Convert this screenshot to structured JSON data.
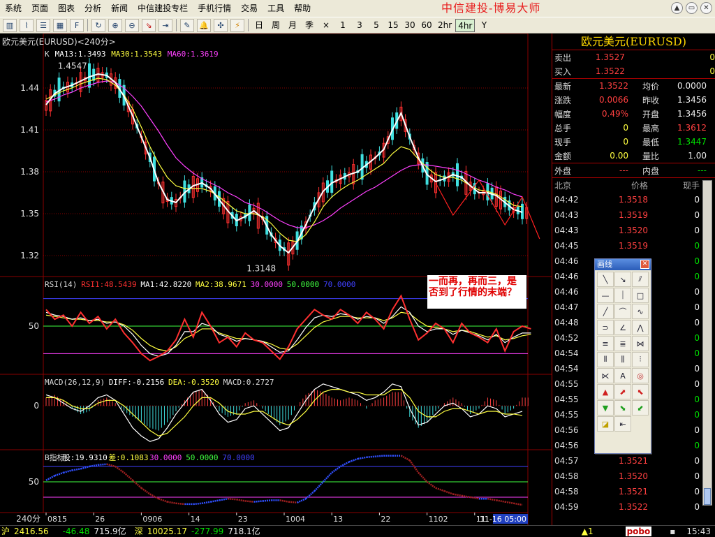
{
  "app": {
    "brand": "中信建投-博易大师",
    "menu": [
      "系统",
      "页面",
      "图表",
      "分析",
      "新闻",
      "中信建投专栏",
      "手机行情",
      "交易",
      "工具",
      "帮助"
    ],
    "window_buttons": [
      "▲",
      "▭",
      "✕"
    ]
  },
  "toolbar": {
    "periods": [
      "日",
      "周",
      "月",
      "季",
      "×",
      "1",
      "3",
      "5",
      "15",
      "30",
      "60",
      "2hr",
      "4hr",
      "Y"
    ],
    "active_period": "4hr"
  },
  "chart": {
    "title": "欧元美元(EURUSD)<240分>",
    "annotation": "一而再，再而三，是否到了行情的末端？",
    "high_label": "1.4547",
    "low_label": "1.3148"
  },
  "chart_data": [
    {
      "type": "line",
      "panel": "K",
      "legend": [
        {
          "text": "K",
          "color": "#dddddd"
        },
        {
          "text": "MA13:1.3493",
          "color": "#ffffff"
        },
        {
          "text": "MA30:1.3543",
          "color": "#ffff40"
        },
        {
          "text": "MA60:1.3619",
          "color": "#ff40ff"
        }
      ],
      "y_ticks": [
        1.44,
        1.41,
        1.38,
        1.35,
        1.32
      ],
      "ylim": [
        1.305,
        1.47
      ],
      "x_ticks": [
        "0815",
        "26",
        "0906",
        "14",
        "23",
        "1004",
        "13",
        "22",
        "1102",
        "11",
        "11-16 05:00"
      ],
      "x_ticks_index": [
        0,
        12,
        24,
        36,
        48,
        60,
        72,
        84,
        96,
        108,
        120
      ],
      "high": 1.4547,
      "low": 1.3148,
      "series": [
        {
          "name": "MA13",
          "color": "#ffffff",
          "values": [
            1.428,
            1.436,
            1.44,
            1.442,
            1.445,
            1.448,
            1.45,
            1.449,
            1.444,
            1.434,
            1.42,
            1.405,
            1.39,
            1.372,
            1.36,
            1.358,
            1.365,
            1.37,
            1.372,
            1.368,
            1.36,
            1.352,
            1.345,
            1.348,
            1.352,
            1.347,
            1.335,
            1.327,
            1.322,
            1.33,
            1.342,
            1.355,
            1.366,
            1.372,
            1.375,
            1.378,
            1.38,
            1.385,
            1.39,
            1.396,
            1.41,
            1.422,
            1.405,
            1.39,
            1.378,
            1.373,
            1.375,
            1.378,
            1.376,
            1.37,
            1.365,
            1.365,
            1.363,
            1.358,
            1.353,
            1.351
          ]
        },
        {
          "name": "MA30",
          "color": "#ffff40",
          "values": [
            1.432,
            1.435,
            1.438,
            1.44,
            1.443,
            1.445,
            1.447,
            1.446,
            1.442,
            1.435,
            1.425,
            1.412,
            1.398,
            1.386,
            1.376,
            1.37,
            1.368,
            1.368,
            1.368,
            1.366,
            1.362,
            1.357,
            1.352,
            1.35,
            1.35,
            1.348,
            1.343,
            1.336,
            1.331,
            1.33,
            1.335,
            1.344,
            1.355,
            1.362,
            1.367,
            1.371,
            1.374,
            1.378,
            1.382,
            1.386,
            1.393,
            1.398,
            1.396,
            1.389,
            1.383,
            1.378,
            1.376,
            1.376,
            1.374,
            1.37,
            1.367,
            1.366,
            1.364,
            1.36,
            1.356,
            1.355
          ]
        },
        {
          "name": "MA60",
          "color": "#ff40ff",
          "values": [
            1.43,
            1.432,
            1.435,
            1.437,
            1.44,
            1.442,
            1.444,
            1.445,
            1.444,
            1.44,
            1.434,
            1.427,
            1.418,
            1.409,
            1.399,
            1.39,
            1.384,
            1.379,
            1.375,
            1.372,
            1.369,
            1.365,
            1.362,
            1.358,
            1.356,
            1.353,
            1.349,
            1.345,
            1.342,
            1.34,
            1.34,
            1.342,
            1.345,
            1.349,
            1.354,
            1.358,
            1.362,
            1.366,
            1.369,
            1.373,
            1.377,
            1.381,
            1.384,
            1.385,
            1.385,
            1.384,
            1.383,
            1.382,
            1.38,
            1.377,
            1.374,
            1.372,
            1.369,
            1.367,
            1.364,
            1.362
          ]
        }
      ]
    },
    {
      "type": "line",
      "panel": "RSI",
      "legend": [
        {
          "text": "RSI(14)",
          "color": "#dddddd"
        },
        {
          "text": "RSI1:48.5439",
          "color": "#ff3030"
        },
        {
          "text": "MA1:42.8220",
          "color": "#ffffff"
        },
        {
          "text": "MA2:38.9671",
          "color": "#ffff40"
        },
        {
          "text": "30.0000",
          "color": "#ff40ff"
        },
        {
          "text": "50.0000",
          "color": "#40ff40"
        },
        {
          "text": "70.0000",
          "color": "#4040ff"
        }
      ],
      "y_ticks": [
        50
      ],
      "ylim": [
        15,
        85
      ],
      "ref_lines": [
        {
          "value": 70,
          "color": "#4040ff"
        },
        {
          "value": 50,
          "color": "#40ff40"
        },
        {
          "value": 30,
          "color": "#ff40ff"
        }
      ],
      "series": [
        {
          "name": "RSI1",
          "color": "#ff3030",
          "values": [
            62,
            55,
            58,
            50,
            60,
            52,
            57,
            48,
            55,
            45,
            38,
            30,
            25,
            28,
            32,
            40,
            55,
            42,
            60,
            50,
            38,
            42,
            35,
            45,
            40,
            38,
            32,
            26,
            35,
            48,
            55,
            62,
            58,
            55,
            62,
            58,
            52,
            60,
            55,
            48,
            62,
            72,
            55,
            40,
            45,
            52,
            48,
            38,
            52,
            45,
            42,
            38,
            48,
            32,
            46,
            50,
            48
          ]
        },
        {
          "name": "MA1",
          "color": "#ffffff",
          "values": [
            60,
            58,
            57,
            55,
            56,
            54,
            55,
            52,
            53,
            50,
            44,
            36,
            30,
            28,
            30,
            36,
            46,
            46,
            52,
            50,
            44,
            42,
            39,
            41,
            40,
            39,
            35,
            31,
            32,
            40,
            49,
            56,
            58,
            57,
            59,
            58,
            55,
            57,
            56,
            52,
            57,
            64,
            60,
            50,
            46,
            48,
            48,
            44,
            47,
            45,
            43,
            40,
            44,
            38,
            42,
            45,
            45
          ]
        },
        {
          "name": "MA2",
          "color": "#ffff40",
          "values": [
            58,
            57,
            56,
            55,
            55,
            54,
            54,
            53,
            53,
            51,
            47,
            41,
            36,
            33,
            32,
            35,
            41,
            44,
            48,
            48,
            45,
            43,
            41,
            41,
            40,
            39,
            37,
            34,
            33,
            37,
            43,
            49,
            53,
            55,
            57,
            57,
            56,
            56,
            56,
            54,
            56,
            60,
            59,
            54,
            50,
            49,
            48,
            46,
            47,
            46,
            44,
            42,
            43,
            40,
            41,
            43,
            44
          ]
        }
      ]
    },
    {
      "type": "bar",
      "panel": "MACD",
      "legend": [
        {
          "text": "MACD(26,12,9)",
          "color": "#dddddd"
        },
        {
          "text": "DIFF:-0.2156",
          "color": "#ffffff"
        },
        {
          "text": "DEA:-0.3520",
          "color": "#ffff40"
        },
        {
          "text": "MACD:0.2727",
          "color": "#dddddd"
        }
      ],
      "y_ticks": [
        0
      ],
      "ylim": [
        -1.6,
        1.1
      ],
      "histogram": [
        0.3,
        0.4,
        0.2,
        -0.1,
        -0.3,
        -0.2,
        0.2,
        0.3,
        0.1,
        -0.2,
        -0.4,
        -0.6,
        -0.8,
        -0.9,
        -0.6,
        -0.2,
        0.2,
        0.5,
        0.6,
        0.3,
        -0.2,
        -0.4,
        -0.3,
        0.1,
        0.2,
        -0.1,
        -0.4,
        -0.7,
        -0.5,
        0.0,
        0.4,
        0.6,
        0.5,
        0.3,
        0.2,
        0.3,
        0.2,
        -0.1,
        0.2,
        0.3,
        0.5,
        0.5,
        -0.4,
        -0.8,
        -0.6,
        -0.2,
        0.1,
        0.3,
        0.1,
        -0.3,
        -0.1,
        0.3,
        0.2,
        -0.3,
        -0.1,
        0.3
      ],
      "series": [
        {
          "name": "DIFF",
          "color": "#ffffff",
          "values": [
            0.4,
            0.3,
            0.1,
            -0.1,
            -0.2,
            0.0,
            0.3,
            0.4,
            0.2,
            -0.3,
            -0.8,
            -1.1,
            -1.3,
            -1.2,
            -0.8,
            -0.3,
            0.1,
            0.5,
            0.6,
            0.2,
            -0.3,
            -0.6,
            -0.5,
            -0.1,
            0.0,
            -0.3,
            -0.6,
            -0.9,
            -0.8,
            -0.3,
            0.2,
            0.6,
            0.8,
            0.7,
            0.6,
            0.5,
            0.4,
            0.2,
            0.3,
            0.5,
            0.8,
            0.7,
            -0.1,
            -0.7,
            -0.6,
            -0.3,
            0.0,
            0.1,
            -0.1,
            -0.4,
            -0.3,
            0.0,
            -0.1,
            -0.4,
            -0.3,
            -0.2
          ]
        },
        {
          "name": "DEA",
          "color": "#ffff40",
          "values": [
            0.3,
            0.3,
            0.2,
            0.0,
            -0.1,
            -0.1,
            0.1,
            0.2,
            0.2,
            0.0,
            -0.3,
            -0.6,
            -0.9,
            -1.1,
            -1.0,
            -0.7,
            -0.4,
            0.0,
            0.3,
            0.3,
            0.1,
            -0.2,
            -0.3,
            -0.3,
            -0.2,
            -0.2,
            -0.4,
            -0.6,
            -0.7,
            -0.5,
            -0.2,
            0.2,
            0.5,
            0.6,
            0.6,
            0.5,
            0.5,
            0.4,
            0.4,
            0.4,
            0.6,
            0.6,
            0.3,
            -0.2,
            -0.4,
            -0.4,
            -0.2,
            -0.1,
            -0.1,
            -0.2,
            -0.3,
            -0.2,
            -0.2,
            -0.3,
            -0.3,
            -0.35
          ]
        }
      ]
    },
    {
      "type": "line",
      "panel": "B指标",
      "legend": [
        {
          "text": "B指标",
          "color": "#dddddd"
        },
        {
          "text": "股:19.9310",
          "color": "#ffffff"
        },
        {
          "text": "差:0.1083",
          "color": "#ffff40"
        },
        {
          "text": "30.0000",
          "color": "#ff40ff"
        },
        {
          "text": "50.0000",
          "color": "#40ff40"
        },
        {
          "text": "70.0000",
          "color": "#4040ff"
        }
      ],
      "y_ticks": [
        50
      ],
      "ylim": [
        10,
        90
      ],
      "ref_lines": [
        {
          "value": 70,
          "color": "#4040ff"
        },
        {
          "value": 50,
          "color": "#40ff40"
        },
        {
          "value": 30,
          "color": "#ff40ff"
        }
      ],
      "series": [
        {
          "name": "股",
          "color": "#3050ff",
          "values": [
            52,
            58,
            62,
            65,
            67,
            70,
            72,
            73,
            70,
            62,
            52,
            42,
            34,
            28,
            24,
            22,
            21,
            21,
            22,
            24,
            26,
            28,
            27,
            25,
            24,
            25,
            26,
            26,
            24,
            23,
            28,
            38,
            50,
            62,
            70,
            76,
            80,
            82,
            83,
            84,
            84,
            84,
            78,
            62,
            50,
            42,
            38,
            34,
            32,
            30,
            28,
            28,
            26,
            24,
            22,
            20
          ]
        }
      ]
    }
  ],
  "quote": {
    "title": "欧元美元(EURUSD)",
    "sell_label": "卖出",
    "sell_price": "1.3527",
    "sell_qty": "0",
    "buy_label": "买入",
    "buy_price": "1.3522",
    "buy_qty": "0",
    "rows": [
      {
        "l1": "最新",
        "v1": "1.3522",
        "c1": "red",
        "l2": "均价",
        "v2": "0.0000",
        "c2": "wht"
      },
      {
        "l1": "涨跌",
        "v1": "0.0066",
        "c1": "red",
        "l2": "昨收",
        "v2": "1.3456",
        "c2": "wht"
      },
      {
        "l1": "幅度",
        "v1": "0.49%",
        "c1": "red",
        "l2": "开盘",
        "v2": "1.3456",
        "c2": "wht"
      },
      {
        "l1": "总手",
        "v1": "0",
        "c1": "ylw",
        "l2": "最高",
        "v2": "1.3612",
        "c2": "red"
      },
      {
        "l1": "现手",
        "v1": "0",
        "c1": "ylw",
        "l2": "最低",
        "v2": "1.3447",
        "c2": "grn"
      },
      {
        "l1": "金额",
        "v1": "0.00",
        "c1": "ylw",
        "l2": "量比",
        "v2": "1.00",
        "c2": "wht"
      }
    ],
    "outer_label": "外盘",
    "outer_val": "---",
    "inner_label": "内盘",
    "inner_val": "---"
  },
  "ticks": {
    "headers": [
      "北京",
      "价格",
      "现手"
    ],
    "rows": [
      {
        "t": "04:42",
        "p": "1.3518",
        "q": "0",
        "qc": "wht"
      },
      {
        "t": "04:43",
        "p": "1.3519",
        "q": "0",
        "qc": "wht"
      },
      {
        "t": "04:43",
        "p": "1.3520",
        "q": "0",
        "qc": "wht"
      },
      {
        "t": "04:45",
        "p": "1.3519",
        "q": "0",
        "qc": "grn"
      },
      {
        "t": "04:46",
        "p": "",
        "q": "0",
        "qc": "grn"
      },
      {
        "t": "04:46",
        "p": "",
        "q": "0",
        "qc": "grn"
      },
      {
        "t": "04:46",
        "p": "",
        "q": "0",
        "qc": "wht"
      },
      {
        "t": "04:47",
        "p": "",
        "q": "0",
        "qc": "wht"
      },
      {
        "t": "04:48",
        "p": "",
        "q": "0",
        "qc": "wht"
      },
      {
        "t": "04:52",
        "p": "",
        "q": "0",
        "qc": "grn"
      },
      {
        "t": "04:54",
        "p": "",
        "q": "0",
        "qc": "grn"
      },
      {
        "t": "04:54",
        "p": "",
        "q": "0",
        "qc": "wht"
      },
      {
        "t": "04:55",
        "p": "",
        "q": "0",
        "qc": "wht"
      },
      {
        "t": "04:55",
        "p": "",
        "q": "0",
        "qc": "grn"
      },
      {
        "t": "04:55",
        "p": "",
        "q": "0",
        "qc": "grn"
      },
      {
        "t": "04:56",
        "p": "",
        "q": "0",
        "qc": "wht"
      },
      {
        "t": "04:56",
        "p": "",
        "q": "0",
        "qc": "grn"
      },
      {
        "t": "04:57",
        "p": "1.3521",
        "q": "0",
        "qc": "wht"
      },
      {
        "t": "04:58",
        "p": "1.3520",
        "q": "0",
        "qc": "wht"
      },
      {
        "t": "04:58",
        "p": "1.3521",
        "q": "0",
        "qc": "wht"
      },
      {
        "t": "04:59",
        "p": "1.3522",
        "q": "0",
        "qc": "wht"
      }
    ]
  },
  "draw_palette": {
    "title": "画线",
    "tools": [
      "line-tool",
      "ray-tool",
      "parallel-tool",
      "hline-tool",
      "vline-tool",
      "rect-tool",
      "trend-tool",
      "arc-tool",
      "wave-tool",
      "fib-fan-tool",
      "angle-tool",
      "gann-tool",
      "channel-tool",
      "regression-tool",
      "speed-tool",
      "cycle-tool",
      "cycle2-tool",
      "cycle3-tool",
      "triangle-tool",
      "text-tool",
      "target-tool",
      "up-arrow-tool",
      "up-right-arrow-tool",
      "up-left-arrow-tool",
      "down-arrow-tool",
      "down-right-arrow-tool",
      "down-left-arrow-tool",
      "eraser-tool",
      "delete-tool"
    ],
    "text_label": "A"
  },
  "status": {
    "interval": "240分",
    "sh_label": "沪",
    "sh_index": "2416.56",
    "sh_change": "-46.48",
    "sh_amount": "715.9亿",
    "sz_label": "深",
    "sz_index": "10025.17",
    "sz_change": "-277.99",
    "sz_amount": "718.1亿",
    "alert": "▲1",
    "logo": "pobo",
    "clock": "15:43"
  },
  "colors": {
    "up": "#ff3030",
    "down": "#40e0e0",
    "grid": "#8a0000",
    "bg": "#000000"
  }
}
